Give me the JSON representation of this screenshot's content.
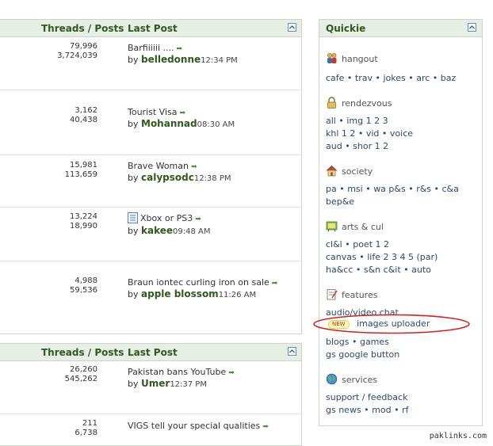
{
  "forum_tables": [
    {
      "header": {
        "threads_posts": "Threads / Posts",
        "last_post": "Last Post"
      },
      "rows": [
        {
          "threads": "79,996",
          "posts": "3,724,039",
          "title": "Barfiiiiii ....",
          "user": "belledonne",
          "time": "12:34 PM"
        },
        {
          "threads": "3,162",
          "posts": "40,438",
          "title": "Tourist Visa",
          "user": "Mohannad",
          "time": "08:30 AM"
        },
        {
          "threads": "15,981",
          "posts": "113,659",
          "title": "Brave Woman",
          "user": "calypsodc",
          "time": "12:38 PM"
        },
        {
          "threads": "13,224",
          "posts": "18,990",
          "title": "Xbox or PS3",
          "user": "kakee",
          "time": "09:48 AM",
          "has_icon": true
        },
        {
          "threads": "4,988",
          "posts": "59,536",
          "title": "Braun iontec curling iron on sale",
          "user": "apple blossom",
          "time": "11:26 AM"
        }
      ]
    },
    {
      "header": {
        "threads_posts": "Threads / Posts",
        "last_post": "Last Post"
      },
      "rows": [
        {
          "threads": "26,260",
          "posts": "545,262",
          "title": "Pakistan bans YouTube",
          "user": "Umer",
          "time": "12:37 PM"
        },
        {
          "threads": "211",
          "posts": "6,738",
          "title": "VIGS tell your special qualities"
        }
      ]
    }
  ],
  "by_label": "by",
  "quickie": {
    "title": "Quickie",
    "sections": [
      {
        "name": "hangout",
        "icon": "people-icon",
        "lines": [
          "cafe • trav • jokes • arc • baz"
        ]
      },
      {
        "name": "rendezvous",
        "icon": "lock-icon",
        "lines": [
          "all • img 1 2 3",
          "khl 1 2 • vid • voice",
          "aud • shor 1 2"
        ]
      },
      {
        "name": "society",
        "icon": "house-icon",
        "lines": [
          "pa • msi • wa p&s • r&s • c&a",
          "bep&e"
        ]
      },
      {
        "name": "arts & cul",
        "icon": "palette-icon",
        "lines": [
          "cl&l • poet 1 2",
          "canvas • life 2 3 4 5 (par)",
          "ha&cc • s&n c&it • auto"
        ]
      },
      {
        "name": "features",
        "icon": "notepad-icon",
        "lines": [
          "audio/video chat",
          "images uploader",
          "blogs • games",
          "gs google button"
        ],
        "new_badge": "NEW"
      },
      {
        "name": "services",
        "icon": "globe-icon",
        "lines": [
          "support / feedback",
          "gs news • mod • rf"
        ]
      }
    ]
  },
  "colors": {
    "header_bg": "#e6efe4",
    "header_text": "#2f5a1e",
    "link": "#2b4a72",
    "highlight_ellipse": "#d81e1e"
  },
  "watermark": "paklinks.com"
}
